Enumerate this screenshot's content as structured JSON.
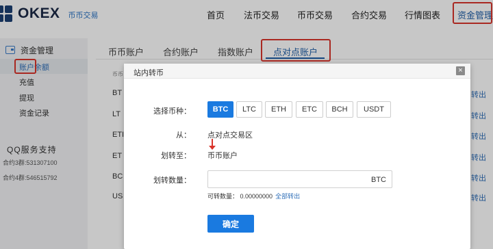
{
  "header": {
    "logo_text": "OKEX",
    "logo_sub": "币币交易",
    "nav": [
      "首页",
      "法币交易",
      "币币交易",
      "合约交易",
      "行情图表",
      "资金管理"
    ],
    "active_nav": "资金管理"
  },
  "sidebar": {
    "title": "资金管理",
    "items": [
      "账户余额",
      "充值",
      "提现",
      "资金记录"
    ],
    "active_item": "账户余额",
    "qq_title": "QQ服务支持",
    "groups": [
      "合约3群:531307100",
      "合约4群:546515792"
    ]
  },
  "tabs": [
    "币币账户",
    "合约账户",
    "指数账户",
    "点对点账户"
  ],
  "active_tab": "点对点账户",
  "background_table": {
    "header_fragment": "币币",
    "rows": [
      "BT",
      "LT",
      "ETI",
      "ET",
      "BC",
      "US"
    ],
    "action_fragment": "转出"
  },
  "modal": {
    "title": "站内转币",
    "close_icon": "×",
    "currency_label": "选择币种：",
    "currencies": [
      "BTC",
      "LTC",
      "ETH",
      "ETC",
      "BCH",
      "USDT"
    ],
    "selected_currency": "BTC",
    "from_label": "从：",
    "from_value": "点对点交易区",
    "to_label": "划转至：",
    "to_value": "币币账户",
    "amount_label": "划转数量：",
    "amount_unit": "BTC",
    "available_text": "可转数量： 0.00000000",
    "transfer_all": "全部转出",
    "confirm": "确定"
  },
  "colors": {
    "accent": "#1a7ae0",
    "brand": "#1b2a47",
    "highlight": "#d9342b",
    "link": "#2f6fb8"
  }
}
